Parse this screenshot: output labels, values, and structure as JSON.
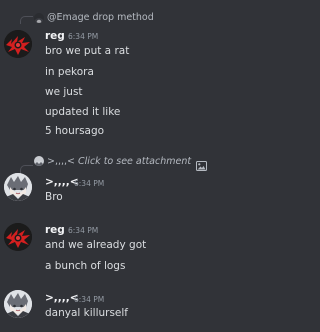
{
  "messages": [
    {
      "reply": {
        "author": "@Emage",
        "text": "drop method"
      },
      "author": "reg",
      "time": "6:34 PM",
      "lines": [
        "bro we put a rat",
        "in pekora",
        "we just",
        "updated it like",
        "5 hoursago"
      ],
      "avatar_icon": "red-spiky-avatar"
    },
    {
      "reply": {
        "author": ">,,,,<",
        "text": "Click to see attachment"
      },
      "author": ">,,,,<",
      "time": "6:34 PM",
      "lines": [
        "Bro"
      ],
      "avatar_icon": "anime-avatar"
    },
    {
      "author": "reg",
      "time": "6:34 PM",
      "lines": [
        "and we already got",
        "a bunch of logs"
      ],
      "avatar_icon": "red-spiky-avatar"
    },
    {
      "author": ">,,,,<",
      "time": "6:34 PM",
      "lines": [
        "danyal killurself"
      ],
      "avatar_icon": "anime-avatar"
    }
  ],
  "colors": {
    "background": "#313338",
    "text": "#dbdee1",
    "username": "#f2f3f5",
    "muted": "#949ba4"
  }
}
